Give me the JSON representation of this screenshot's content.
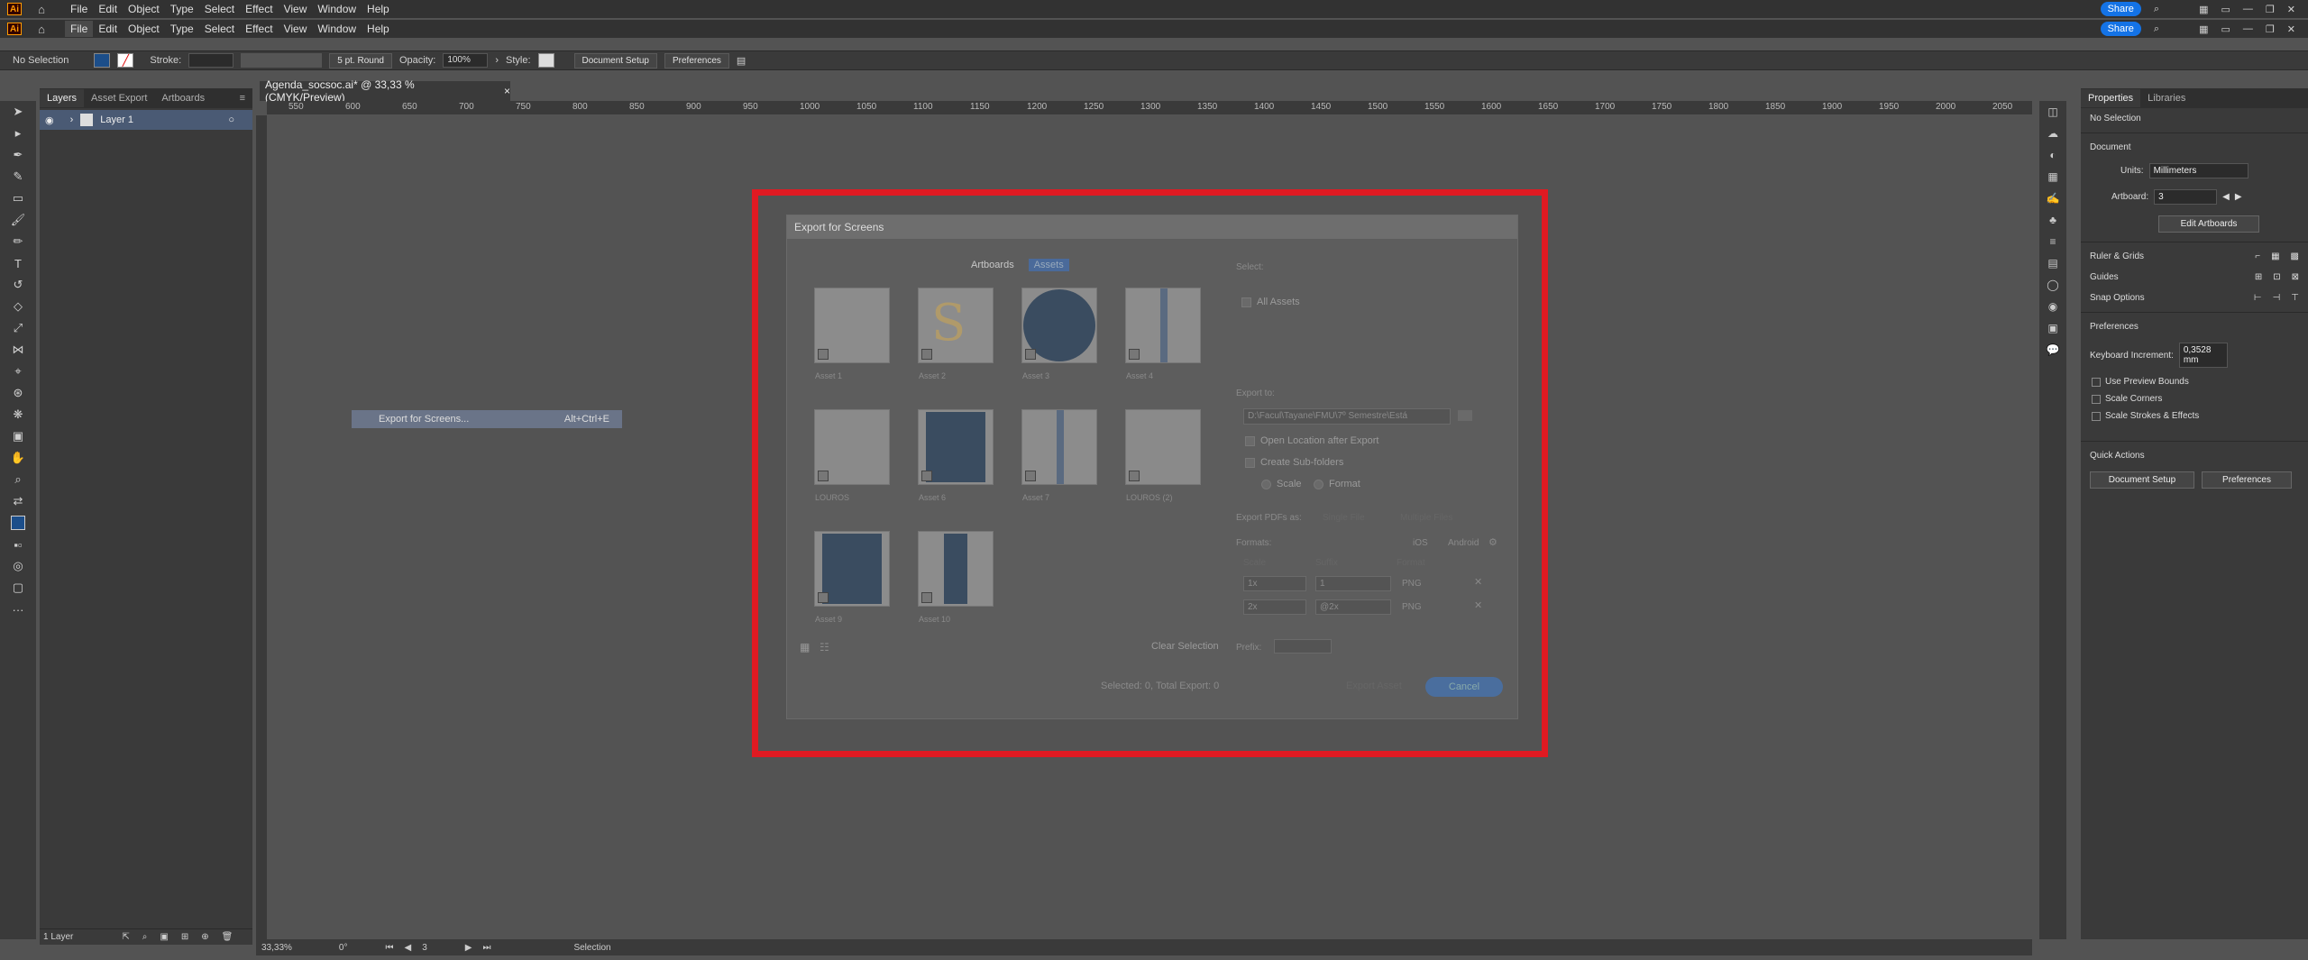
{
  "app": {
    "logo": "Ai",
    "menus": [
      "File",
      "Edit",
      "Object",
      "Type",
      "Select",
      "Effect",
      "View",
      "Window",
      "Help"
    ],
    "share": "Share"
  },
  "control": {
    "selection": "No Selection",
    "stroke_label": "Stroke:",
    "brush": "5 pt. Round",
    "opacity_label": "Opacity:",
    "opacity_value": "100%",
    "style_label": "Style:",
    "doc_setup": "Document Setup",
    "preferences": "Preferences"
  },
  "left_panel": {
    "tabs": [
      "Layers",
      "Asset Export",
      "Artboards"
    ],
    "layer_name": "Layer 1",
    "footer": "1 Layer"
  },
  "document": {
    "tab_title": "Agenda_socsoc.ai* @ 33,33 % (CMYK/Preview)",
    "close": "×"
  },
  "ruler_ticks": [
    "550",
    "600",
    "650",
    "700",
    "750",
    "800",
    "850",
    "900",
    "950",
    "1000",
    "1050",
    "1100",
    "1150",
    "1200",
    "1250",
    "1300",
    "1350",
    "1400",
    "1450",
    "1500",
    "1550",
    "1600",
    "1650",
    "1700",
    "1750",
    "1800",
    "1850",
    "1900",
    "1950",
    "2000",
    "2050"
  ],
  "status": {
    "zoom": "33,33%",
    "rotation": "0°",
    "artboard": "3",
    "tool": "Selection"
  },
  "context_menu": {
    "label": "Export for Screens...",
    "shortcut": "Alt+Ctrl+E"
  },
  "dialog": {
    "title": "Export for Screens",
    "tabs": [
      "Artboards",
      "Assets"
    ],
    "assets": [
      {
        "label": "Asset 1"
      },
      {
        "label": "Asset 2"
      },
      {
        "label": "Asset 3"
      },
      {
        "label": "Asset 4"
      },
      {
        "label": "LOUROS"
      },
      {
        "label": "Asset 6"
      },
      {
        "label": "Asset 7"
      },
      {
        "label": "LOUROS (2)"
      },
      {
        "label": "Asset 9"
      },
      {
        "label": "Asset 10"
      }
    ],
    "select_label": "Select:",
    "all_assets": "All Assets",
    "export_to_label": "Export to:",
    "export_path": "D:\\Facul\\Tayane\\FMU\\7º Semestre\\Está",
    "open_location": "Open Location after Export",
    "create_subfolders": "Create Sub-folders",
    "scale": "Scale",
    "format": "Format",
    "export_pdfs": "Export PDFs as:",
    "single_file": "Single File",
    "multiple_files": "Multiple Files",
    "formats_label": "Formats:",
    "ios": "iOS",
    "android": "Android",
    "col_scale": "Scale",
    "col_suffix": "Suffix",
    "col_format": "Format",
    "rows": [
      {
        "scale": "1x",
        "suffix": "1",
        "format": "PNG"
      },
      {
        "scale": "2x",
        "suffix": "@2x",
        "format": "PNG"
      }
    ],
    "clear_selection": "Clear Selection",
    "prefix_label": "Prefix:",
    "summary": "Selected: 0, Total Export: 0",
    "export_btn": "Export Asset",
    "cancel_btn": "Cancel"
  },
  "properties": {
    "tabs": [
      "Properties",
      "Libraries"
    ],
    "no_selection": "No Selection",
    "document": "Document",
    "units_label": "Units:",
    "units": "Millimeters",
    "artboard_label": "Artboard:",
    "artboard": "3",
    "edit_artboards": "Edit Artboards",
    "ruler_grids": "Ruler & Grids",
    "guides": "Guides",
    "snap": "Snap Options",
    "prefs": "Preferences",
    "keyboard_inc_label": "Keyboard Increment:",
    "keyboard_inc": "0,3528 mm",
    "use_preview": "Use Preview Bounds",
    "scale_corners": "Scale Corners",
    "scale_strokes": "Scale Strokes & Effects",
    "quick_actions": "Quick Actions",
    "doc_setup": "Document Setup",
    "preferences": "Preferences"
  }
}
